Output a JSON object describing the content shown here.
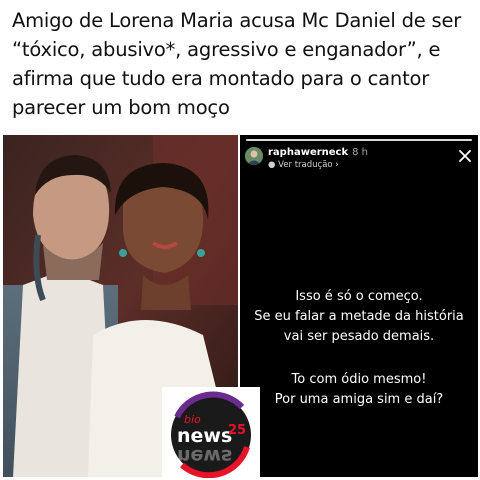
{
  "headline": "Amigo de Lorena Maria acusa Mc Daniel de ser “tóxico, abusivo*, agressivo e enganador”, e afirma que tudo era montado para o cantor parecer um bom moço",
  "story": {
    "username": "raphawerneck",
    "time": "8 h",
    "translate_label": "Ver tradução",
    "paragraph1": [
      "Isso é só o começo.",
      "Se eu falar a metade da história",
      "vai ser pesado demais."
    ],
    "paragraph2": [
      "To com ódio mesmo!",
      "Por uma amiga sim e daí?"
    ],
    "close_icon": "close-icon",
    "progress": 1.0
  },
  "logo": {
    "brand": "news",
    "prefix": "bio",
    "suffix": "25",
    "reflection": "news"
  },
  "colors": {
    "story_bg": "#000000",
    "logo_red": "#e8122a",
    "logo_purple": "#6b2c8f"
  }
}
